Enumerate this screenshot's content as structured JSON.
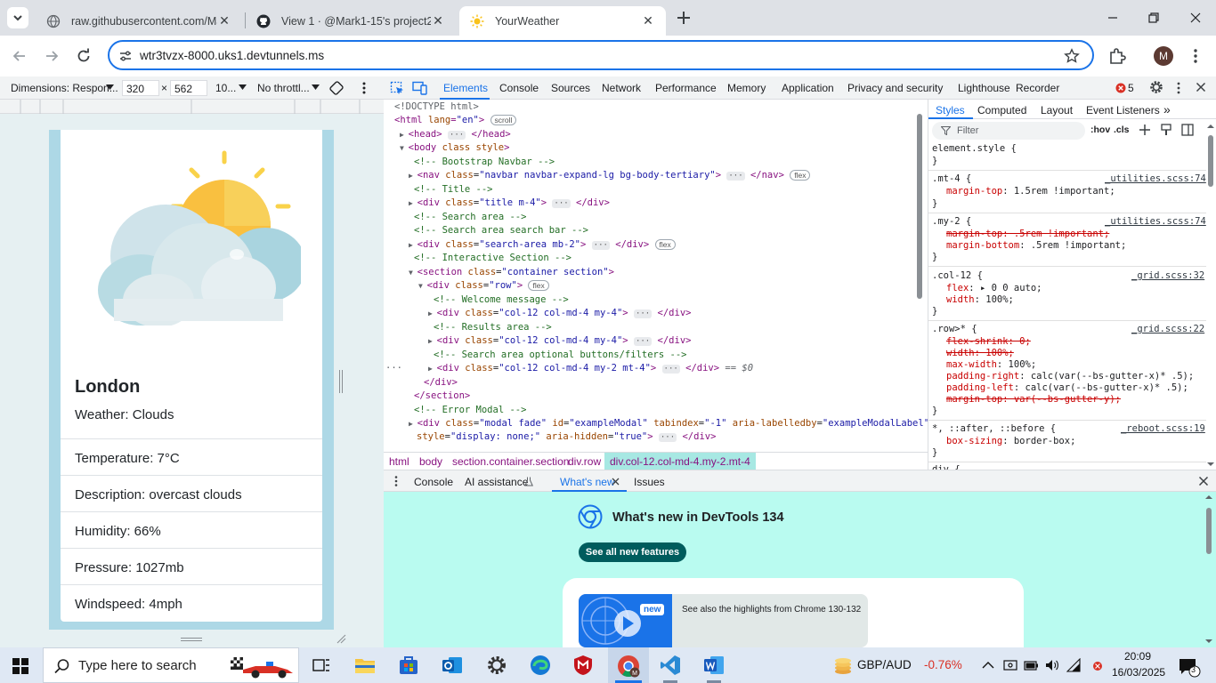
{
  "browser": {
    "tabs": [
      {
        "title": "raw.githubusercontent.com/Ma",
        "icon": "globe-icon"
      },
      {
        "title": "View 1 · @Mark1-15's project2",
        "icon": "github-icon"
      },
      {
        "title": "YourWeather",
        "icon": "sun-favicon"
      }
    ],
    "url": "wtr3tvzx-8000.uks1.devtunnels.ms",
    "profile_initial": "M"
  },
  "device_toolbar": {
    "dimensions_label": "Dimensions: Respon...",
    "width": "320",
    "times": "×",
    "height": "562",
    "zoom": "10...",
    "throttle": "No throttl..."
  },
  "weather_page": {
    "city": "London",
    "condition": "Weather: Clouds",
    "details": [
      "Temperature: 7°C",
      "Description: overcast clouds",
      "Humidity: 66%",
      "Pressure: 1027mb",
      "Windspeed: 4mph"
    ]
  },
  "devtools": {
    "tabs": [
      "Elements",
      "Console",
      "Sources",
      "Network",
      "Performance",
      "Memory",
      "Application",
      "Privacy and security",
      "Lighthouse",
      "Recorder"
    ],
    "error_count": "5",
    "dom": {
      "doctype": "<!DOCTYPE html>",
      "html_open": "html",
      "html_attr": "lang",
      "html_val": "\"en\"",
      "scroll_pill": "scroll",
      "head": "<head>",
      "head_close": "</head>",
      "body_open": "<body",
      "body_attrs": "class style",
      "c_navbar": "<!-- Bootstrap Navbar -->",
      "nav_tag": "<nav",
      "nav_class": "\"navbar navbar-expand-lg bg-body-tertiary\"",
      "nav_close": "</nav>",
      "flex_pill": "flex",
      "c_title": "<!-- Title -->",
      "title_class": "\"title m-4\"",
      "c_search": "<!-- Search area -->",
      "c_searchbar": "<!-- Search area search bar -->",
      "search_class": "\"search-area mb-2\"",
      "c_interactive": "<!-- Interactive Section -->",
      "section_class": "\"container section\"",
      "row_class": "\"row\"",
      "c_welcome": "<!-- Welcome message -->",
      "col_class": "\"col-12 col-md-4 my-4\"",
      "c_results": "<!-- Results area -->",
      "c_buttons": "<!-- Search area optional buttons/filters -->",
      "col_sel_class": "\"col-12 col-md-4 my-2 mt-4\"",
      "sel_marker": "== $0",
      "div_close": "</div>",
      "section_close": "</section>",
      "c_error": "<!-- Error Modal -->",
      "modal_class": "\"modal fade\"",
      "modal_id": "\"exampleModal\"",
      "modal_tab": "\"-1\"",
      "modal_aria": "\"exampleModalLabel\"",
      "modal_style": "\"display: none;\"",
      "modal_hidden": "\"true\"",
      "dots": "···"
    },
    "breadcrumbs": [
      "html",
      "body",
      "section.container.section",
      "div.row",
      "div.col-12.col-md-4.my-2.mt-4"
    ],
    "styles_tabs": [
      "Styles",
      "Computed",
      "Layout",
      "Event Listeners"
    ],
    "filter_placeholder": "Filter",
    "hov": ":hov",
    "cls": ".cls",
    "rules": {
      "element_style": "element.style {",
      "close": "}",
      "mt4_sel": ".mt-4 {",
      "mt4_src": "_utilities.scss:74",
      "mt4_p1": "margin-top",
      "mt4_v1": ": 1.5rem !important;",
      "my2_sel": ".my-2 {",
      "my2_src": "_utilities.scss:74",
      "my2_p1": "margin-top: .5rem !important;",
      "my2_p2": "margin-bottom",
      "my2_v2": ": .5rem !important;",
      "col_sel": ".col-12 {",
      "col_src": "_grid.scss:32",
      "col_p1": "flex",
      "col_v1": ": ▸ 0 0 auto;",
      "col_p2": "width",
      "col_v2": ": 100%;",
      "row_sel": ".row>* {",
      "row_src": "_grid.scss:22",
      "row_s1": "flex-shrink: 0;",
      "row_s2": "width: 100%;",
      "row_p3": "max-width",
      "row_v3": ": 100%;",
      "row_p4": "padding-right",
      "row_v4": ": calc(var(--bs-gutter-x)* .5);",
      "row_p5": "padding-left",
      "row_v5": ": calc(var(--bs-gutter-x)* .5);",
      "row_s6": "margin-top: var(--bs-gutter-y);",
      "all_sel": "*, ::after, ::before {",
      "all_src": "_reboot.scss:19",
      "all_p1": "box-sizing",
      "all_v1": ": border-box;",
      "div_partial": "div {"
    },
    "drawer": {
      "tabs": [
        "Console",
        "AI assistance",
        "What's new",
        "Issues"
      ],
      "whats_new_title": "What's new in DevTools 134",
      "see_all_button": "See all new features",
      "new_badge": "new",
      "highlights_text": "See also the highlights from Chrome 130-132"
    }
  },
  "taskbar": {
    "search_placeholder": "Type here to search",
    "currency_pair": "GBP/AUD",
    "currency_change": "-0.76%",
    "time": "20:09",
    "date": "16/03/2025",
    "notification_count": "3"
  },
  "colors": {
    "accent": "#1a73e8",
    "device_bg": "#add8e6",
    "drawer_bg": "#b9fbf0",
    "negative": "#d93025"
  }
}
